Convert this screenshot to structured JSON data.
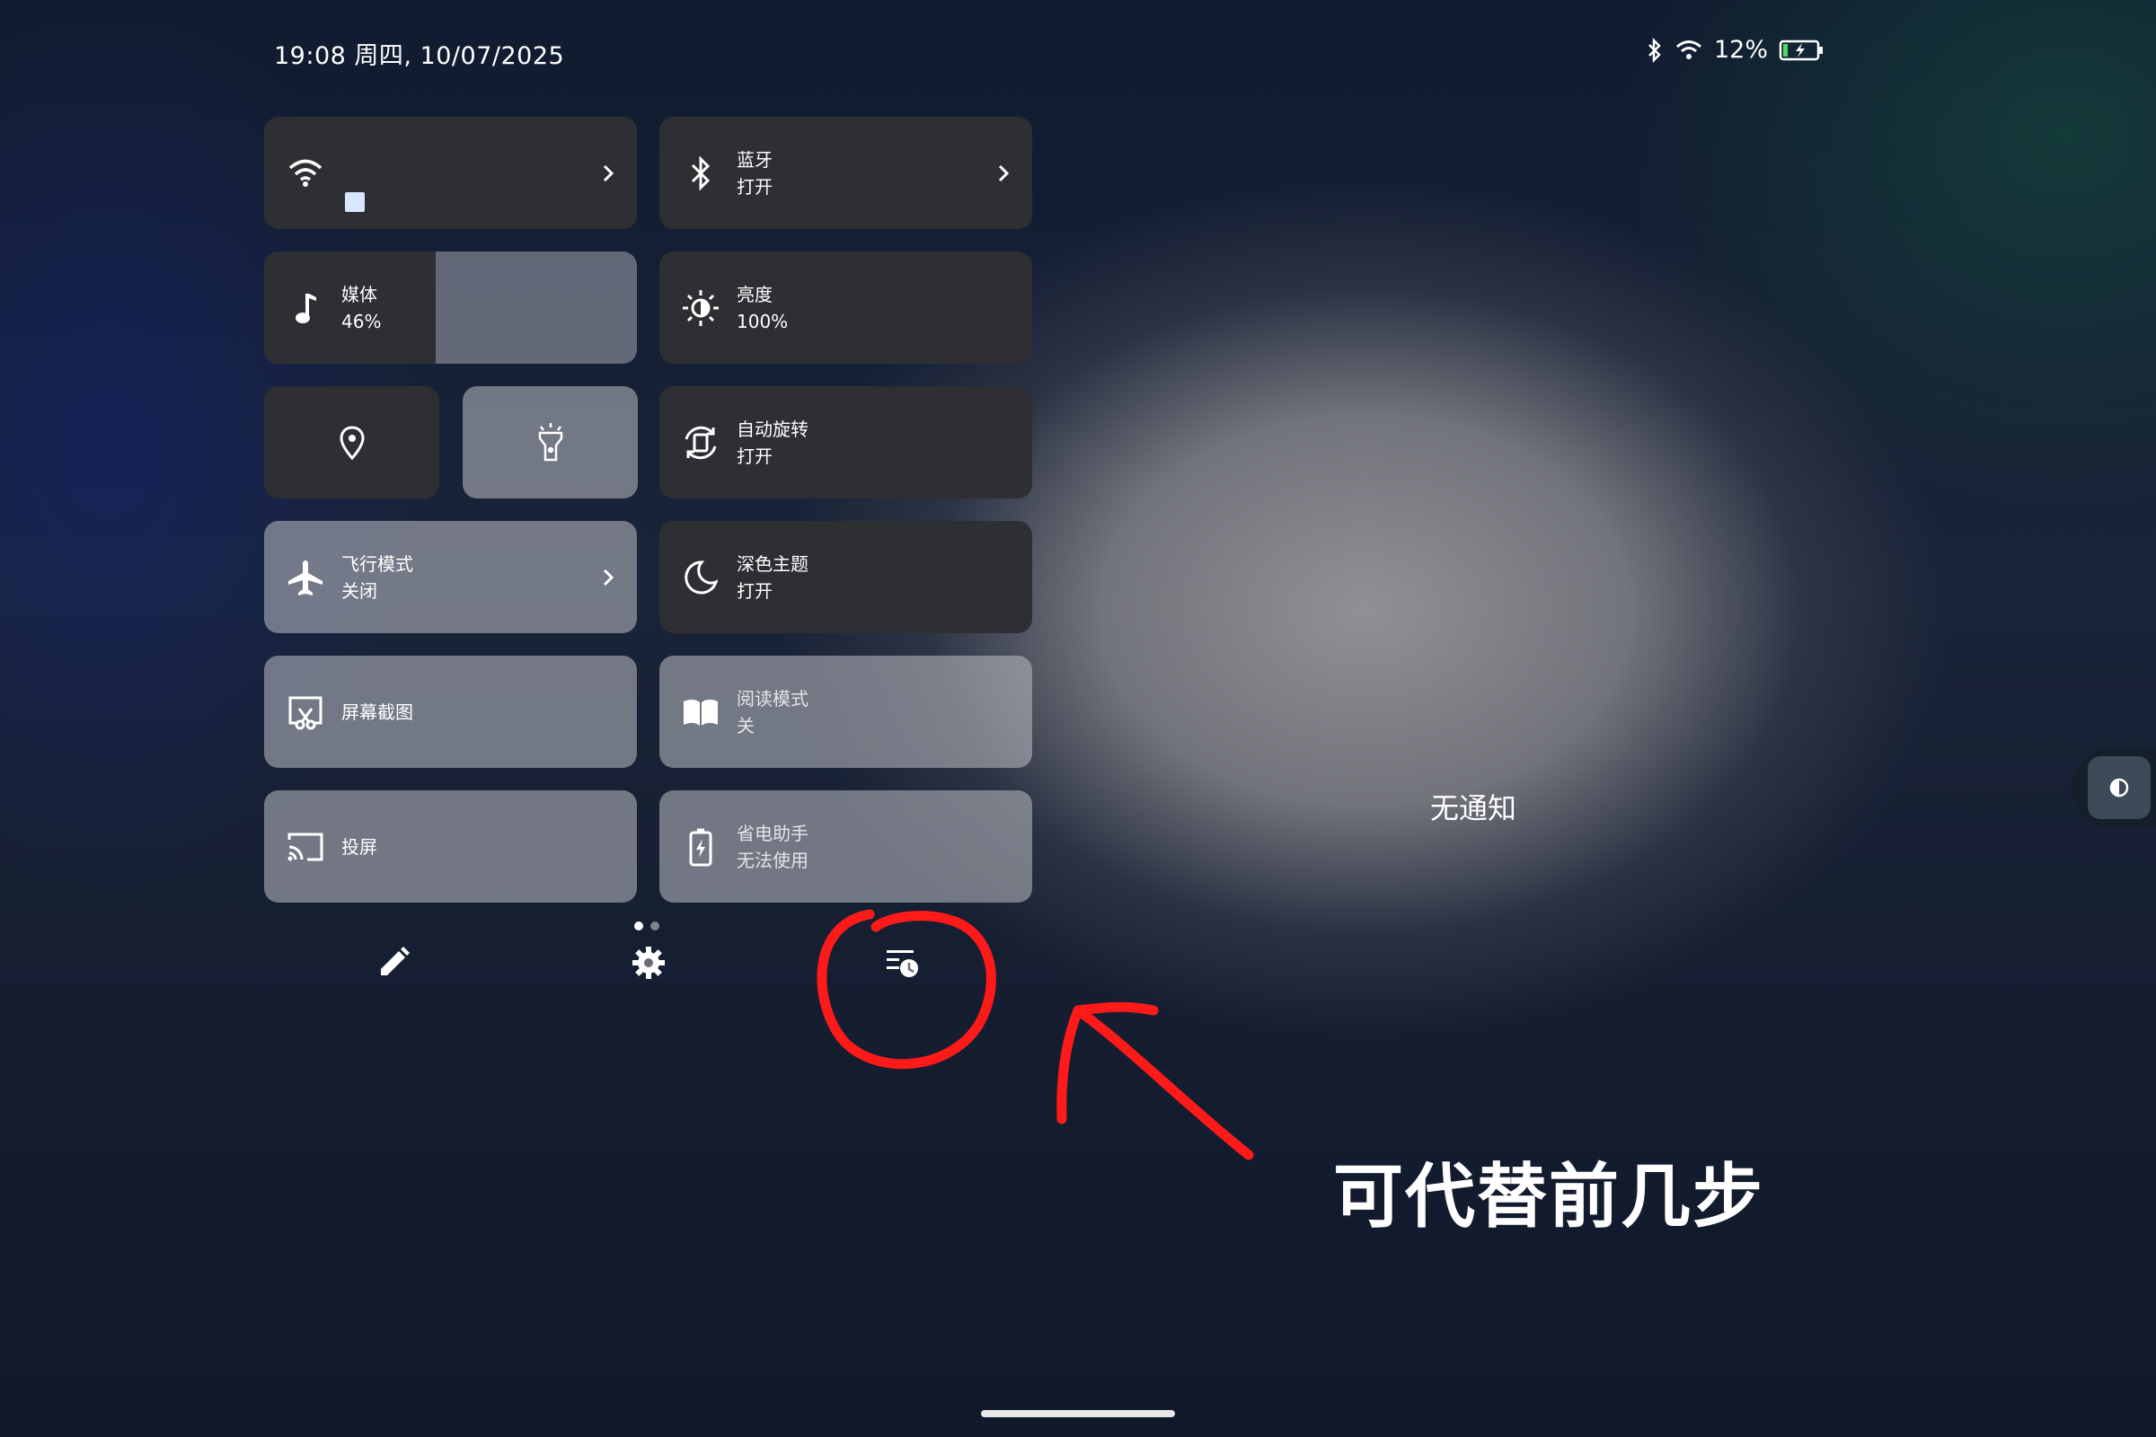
{
  "status_bar": {
    "datetime": "19:08 周四, 10/07/2025",
    "battery": "12%",
    "icons": [
      "bluetooth-icon",
      "wifi-icon",
      "battery-charging-icon"
    ]
  },
  "tiles": {
    "wifi": {
      "label": "",
      "icon": "wifi-icon"
    },
    "bluetooth": {
      "title": "蓝牙",
      "status": "打开",
      "icon": "bluetooth-icon"
    },
    "media": {
      "title": "媒体",
      "value": "46%",
      "level": 0.46,
      "icon": "music-note-icon"
    },
    "brightness": {
      "title": "亮度",
      "value": "100%",
      "icon": "brightness-icon"
    },
    "location": {
      "icon": "location-pin-icon"
    },
    "flashlight": {
      "icon": "flashlight-icon"
    },
    "autorotate": {
      "title": "自动旋转",
      "status": "打开",
      "icon": "rotate-icon"
    },
    "airplane": {
      "title": "飞行模式",
      "status": "关闭",
      "icon": "airplane-icon"
    },
    "dark_theme": {
      "title": "深色主题",
      "status": "打开",
      "icon": "moon-icon"
    },
    "screenshot": {
      "title": "屏幕截图",
      "icon": "screenshot-icon"
    },
    "reading_mode": {
      "title": "阅读模式",
      "status": "关",
      "icon": "book-icon"
    },
    "cast": {
      "title": "投屏",
      "icon": "cast-icon"
    },
    "battery_saver": {
      "title": "省电助手",
      "status": "无法使用",
      "icon": "battery-saver-icon"
    }
  },
  "bottom_bar": {
    "page_indicator": {
      "current": 1,
      "total": 2
    },
    "buttons": [
      "edit-icon",
      "settings-icon",
      "notification-history-icon"
    ]
  },
  "notifications": {
    "empty_text": "无通知"
  },
  "annotation": {
    "text": "可代替前几步",
    "color": "#ff1a1a"
  },
  "colors": {
    "tile_dark": "#2e2f33",
    "tile_light": "rgba(190,192,196,0.55)",
    "accent_red": "#ff1a1a"
  }
}
